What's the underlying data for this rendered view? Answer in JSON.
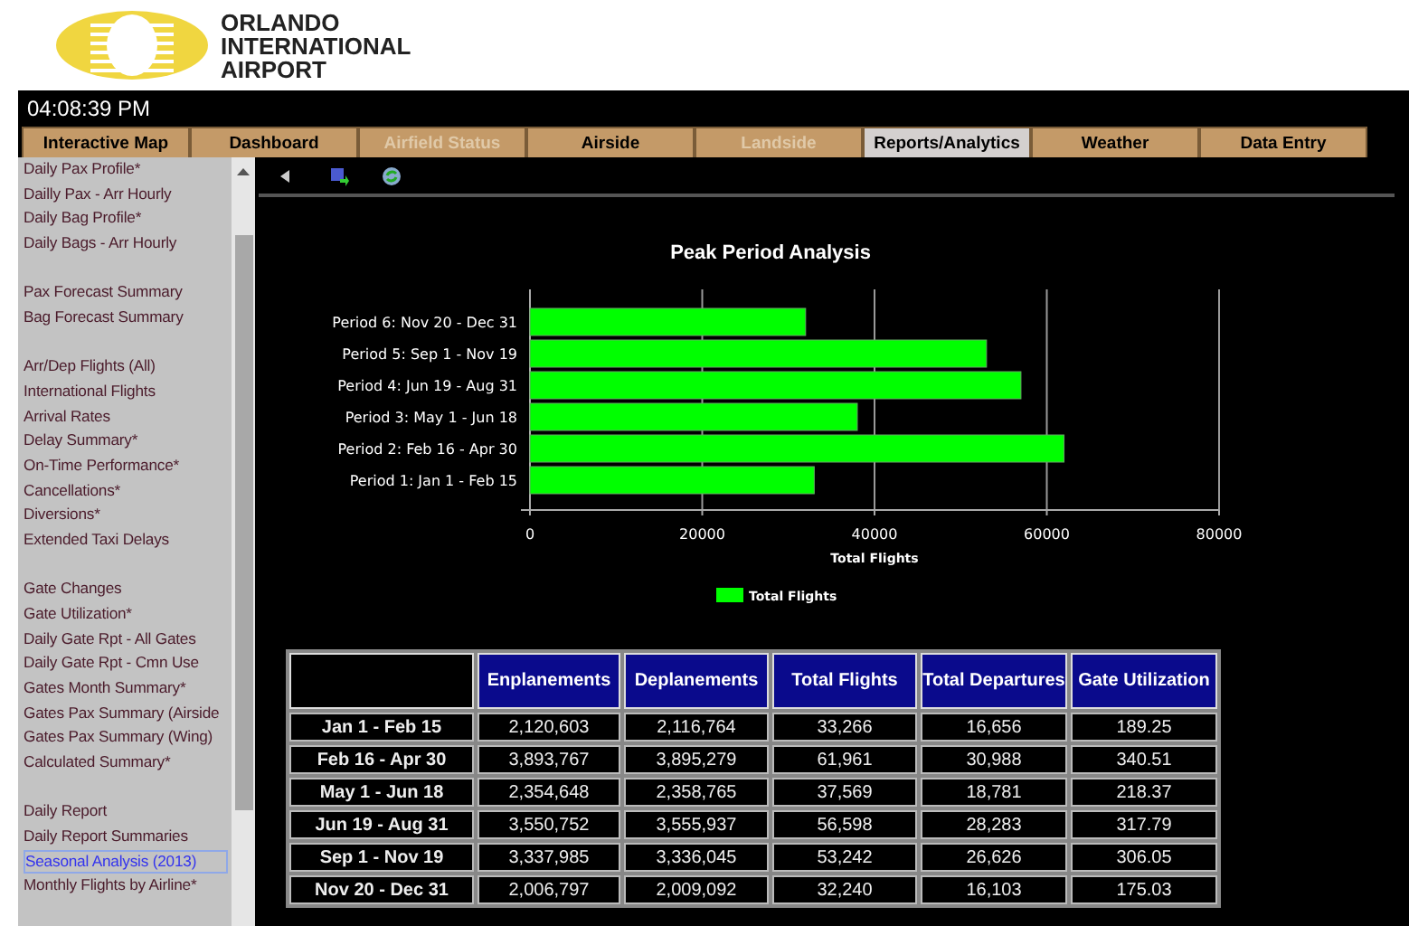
{
  "logo": {
    "lines": [
      "ORLANDO",
      "INTERNATIONAL",
      "AIRPORT"
    ]
  },
  "clock": "04:08:39 PM",
  "tabs": [
    {
      "label": "Interactive Map",
      "selected": false,
      "disabled": false
    },
    {
      "label": "Dashboard",
      "selected": false,
      "disabled": false
    },
    {
      "label": "Airfield Status",
      "selected": false,
      "disabled": true
    },
    {
      "label": "Airside",
      "selected": false,
      "disabled": false
    },
    {
      "label": "Landside",
      "selected": false,
      "disabled": true
    },
    {
      "label": "Reports/Analytics",
      "selected": true,
      "disabled": false
    },
    {
      "label": "Weather",
      "selected": false,
      "disabled": false
    },
    {
      "label": "Data Entry",
      "selected": false,
      "disabled": false
    }
  ],
  "sidebar": {
    "groups": [
      {
        "items": [
          {
            "label": "Daily Pax Profile*",
            "selected": false
          },
          {
            "label": "Dailly Pax - Arr Hourly",
            "selected": false
          },
          {
            "label": "Daily Bag Profile*",
            "selected": false
          },
          {
            "label": "Daily Bags - Arr Hourly",
            "selected": false
          }
        ]
      },
      {
        "items": [
          {
            "label": "Pax Forecast Summary",
            "selected": false
          },
          {
            "label": "Bag Forecast Summary",
            "selected": false
          }
        ]
      },
      {
        "items": [
          {
            "label": "Arr/Dep Flights (All)",
            "selected": false
          },
          {
            "label": "International Flights",
            "selected": false
          },
          {
            "label": "Arrival Rates",
            "selected": false
          },
          {
            "label": "Delay Summary*",
            "selected": false
          },
          {
            "label": "On-Time Performance*",
            "selected": false
          },
          {
            "label": "Cancellations*",
            "selected": false
          },
          {
            "label": "Diversions*",
            "selected": false
          },
          {
            "label": "Extended Taxi Delays",
            "selected": false
          }
        ]
      },
      {
        "items": [
          {
            "label": "Gate Changes",
            "selected": false
          },
          {
            "label": "Gate Utilization*",
            "selected": false
          },
          {
            "label": "Daily Gate Rpt - All Gates",
            "selected": false
          },
          {
            "label": "Daily Gate Rpt - Cmn Use",
            "selected": false
          },
          {
            "label": "Gates Month Summary*",
            "selected": false
          },
          {
            "label": "Gates Pax Summary (Airside",
            "selected": false
          },
          {
            "label": "Gates Pax Summary (Wing)",
            "selected": false
          },
          {
            "label": "Calculated Summary*",
            "selected": false
          }
        ]
      },
      {
        "items": [
          {
            "label": "Daily Report",
            "selected": false
          },
          {
            "label": "Daily Report Summaries",
            "selected": false
          },
          {
            "label": "Seasonal Analysis (2013)",
            "selected": true
          },
          {
            "label": "Monthly Flights by Airline*",
            "selected": false
          }
        ]
      }
    ]
  },
  "chart": {
    "chart_data": {
      "type": "bar",
      "orientation": "horizontal",
      "title": "Peak Period Analysis",
      "xlabel": "Total Flights",
      "categories": [
        "Period 6: Nov 20 - Dec 31",
        "Period 5: Sep 1 - Nov 19",
        "Period 4: Jun 19 - Aug 31",
        "Period 3: May 1 - Jun 18",
        "Period 2: Feb 16 - Apr 30",
        "Period 1: Jan 1 - Feb 15"
      ],
      "series": [
        {
          "name": "Total Flights",
          "color": "#00ff00",
          "values": [
            32000,
            53000,
            57000,
            38000,
            62000,
            33000
          ]
        }
      ],
      "xlim": [
        0,
        80000
      ],
      "xticks": [
        0,
        20000,
        40000,
        60000,
        80000
      ],
      "grid": true
    }
  },
  "table": {
    "columns": [
      "Enplanements",
      "Deplanements",
      "Total Flights",
      "Total Departures",
      "Gate Utilization"
    ],
    "rows": [
      {
        "period": "Jan 1 - Feb 15",
        "cells": [
          "2,120,603",
          "2,116,764",
          "33,266",
          "16,656",
          "189.25"
        ]
      },
      {
        "period": "Feb 16 - Apr 30",
        "cells": [
          "3,893,767",
          "3,895,279",
          "61,961",
          "30,988",
          "340.51"
        ]
      },
      {
        "period": "May 1 - Jun 18",
        "cells": [
          "2,354,648",
          "2,358,765",
          "37,569",
          "18,781",
          "218.37"
        ]
      },
      {
        "period": "Jun 19 - Aug 31",
        "cells": [
          "3,550,752",
          "3,555,937",
          "56,598",
          "28,283",
          "317.79"
        ]
      },
      {
        "period": "Sep 1 - Nov 19",
        "cells": [
          "3,337,985",
          "3,336,045",
          "53,242",
          "26,626",
          "306.05"
        ]
      },
      {
        "period": "Nov 20 - Dec 31",
        "cells": [
          "2,006,797",
          "2,009,092",
          "32,240",
          "16,103",
          "175.03"
        ]
      }
    ]
  }
}
